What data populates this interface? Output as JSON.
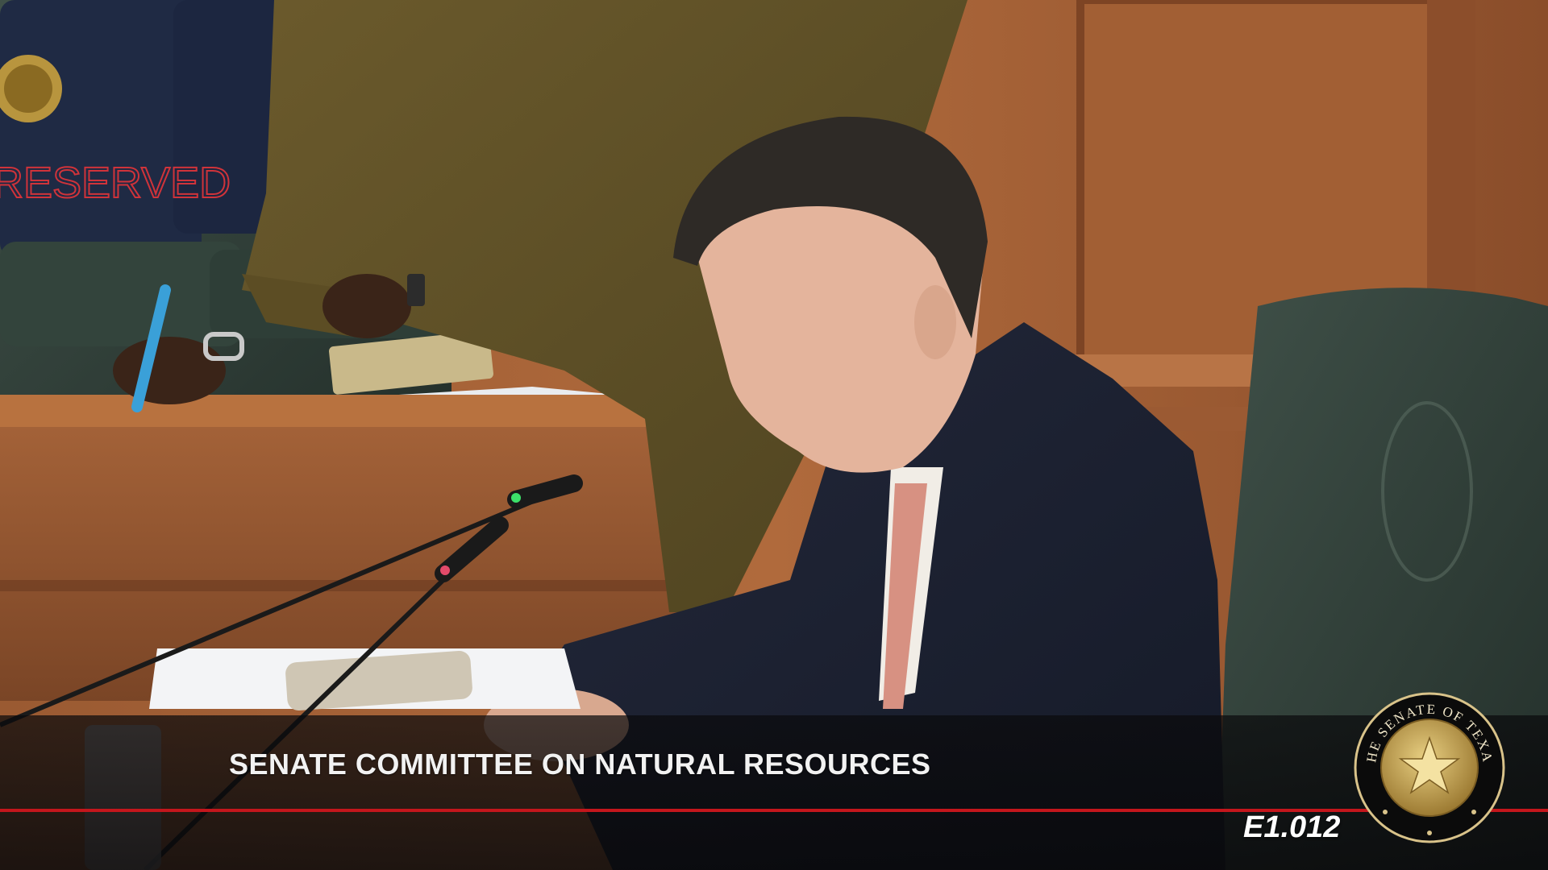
{
  "broadcast": {
    "committee_title": "SENATE COMMITTEE ON NATURAL RESOURCES",
    "room_number": "E1.012",
    "rule_color": "#c4161c"
  },
  "seal": {
    "ring_text": "THE SENATE OF TEXAS",
    "icon": "senate-of-texas-seal-icon"
  },
  "background": {
    "chair_cover_text": "RESERVED"
  }
}
